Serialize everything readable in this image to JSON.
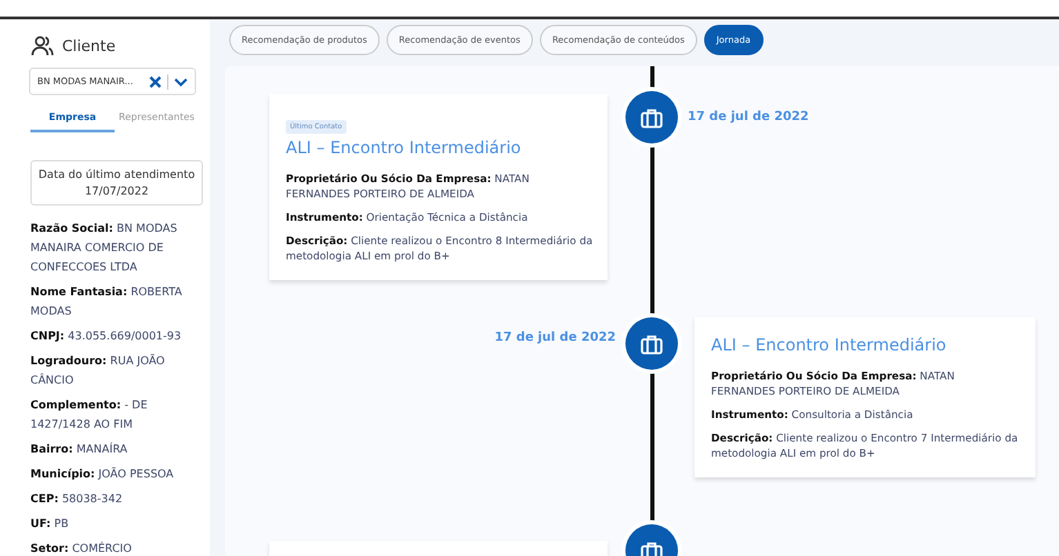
{
  "sidebar": {
    "title": "Cliente",
    "select": {
      "value": "BN MODAS MANAIR..."
    },
    "tabs": [
      {
        "label": "Empresa",
        "selected": true
      },
      {
        "label": "Representantes",
        "selected": false
      }
    ],
    "last_visit": {
      "label": "Data do último atendimento",
      "date": "17/07/2022"
    },
    "fields": [
      {
        "label": "Razão Social:",
        "value": "BN MODAS MANAIRA COMERCIO DE CONFECCOES LTDA"
      },
      {
        "label": "Nome Fantasia:",
        "value": "ROBERTA MODAS"
      },
      {
        "label": "CNPJ:",
        "value": "43.055.669/0001-93"
      },
      {
        "label": "Logradouro:",
        "value": "RUA JOÃO CÂNCIO"
      },
      {
        "label": "Complemento:",
        "value": "- DE 1427/1428 AO FIM"
      },
      {
        "label": "Bairro:",
        "value": "MANAÍRA"
      },
      {
        "label": "Município:",
        "value": "JOÃO PESSOA"
      },
      {
        "label": "CEP:",
        "value": "58038-342"
      },
      {
        "label": "UF:",
        "value": "PB"
      },
      {
        "label": "Setor:",
        "value": "COMÉRCIO"
      }
    ]
  },
  "tabs": [
    {
      "label": "Recomendação de produtos",
      "selected": false
    },
    {
      "label": "Recomendação de eventos",
      "selected": false
    },
    {
      "label": "Recomendação de conteúdos",
      "selected": false
    },
    {
      "label": "Jornada",
      "selected": true
    }
  ],
  "timeline": [
    {
      "kind": "left",
      "badge": "Último Contato",
      "title": "ALI – Encontro Intermediário",
      "date": "17 de jul de 2022",
      "fields": [
        {
          "label": "Proprietário Ou Sócio Da Empresa:",
          "value": "NATAN FERNANDES PORTEIRO DE ALMEIDA"
        },
        {
          "label": "Instrumento:",
          "value": "Orientação Técnica a Distância"
        },
        {
          "label": "Descrição:",
          "value": "Cliente realizou o Encontro 8 Intermediário da metodologia ALI em prol do B+"
        }
      ]
    },
    {
      "kind": "right",
      "title": "ALI – Encontro Intermediário",
      "date": "17 de jul de 2022",
      "fields": [
        {
          "label": "Proprietário Ou Sócio Da Empresa:",
          "value": "NATAN FERNANDES PORTEIRO DE ALMEIDA"
        },
        {
          "label": "Instrumento:",
          "value": "Consultoria a Distância"
        },
        {
          "label": "Descrição:",
          "value": "Cliente realizou o Encontro 7 Intermediário da metodologia ALI em prol do B+"
        }
      ]
    },
    {
      "kind": "left"
    }
  ]
}
